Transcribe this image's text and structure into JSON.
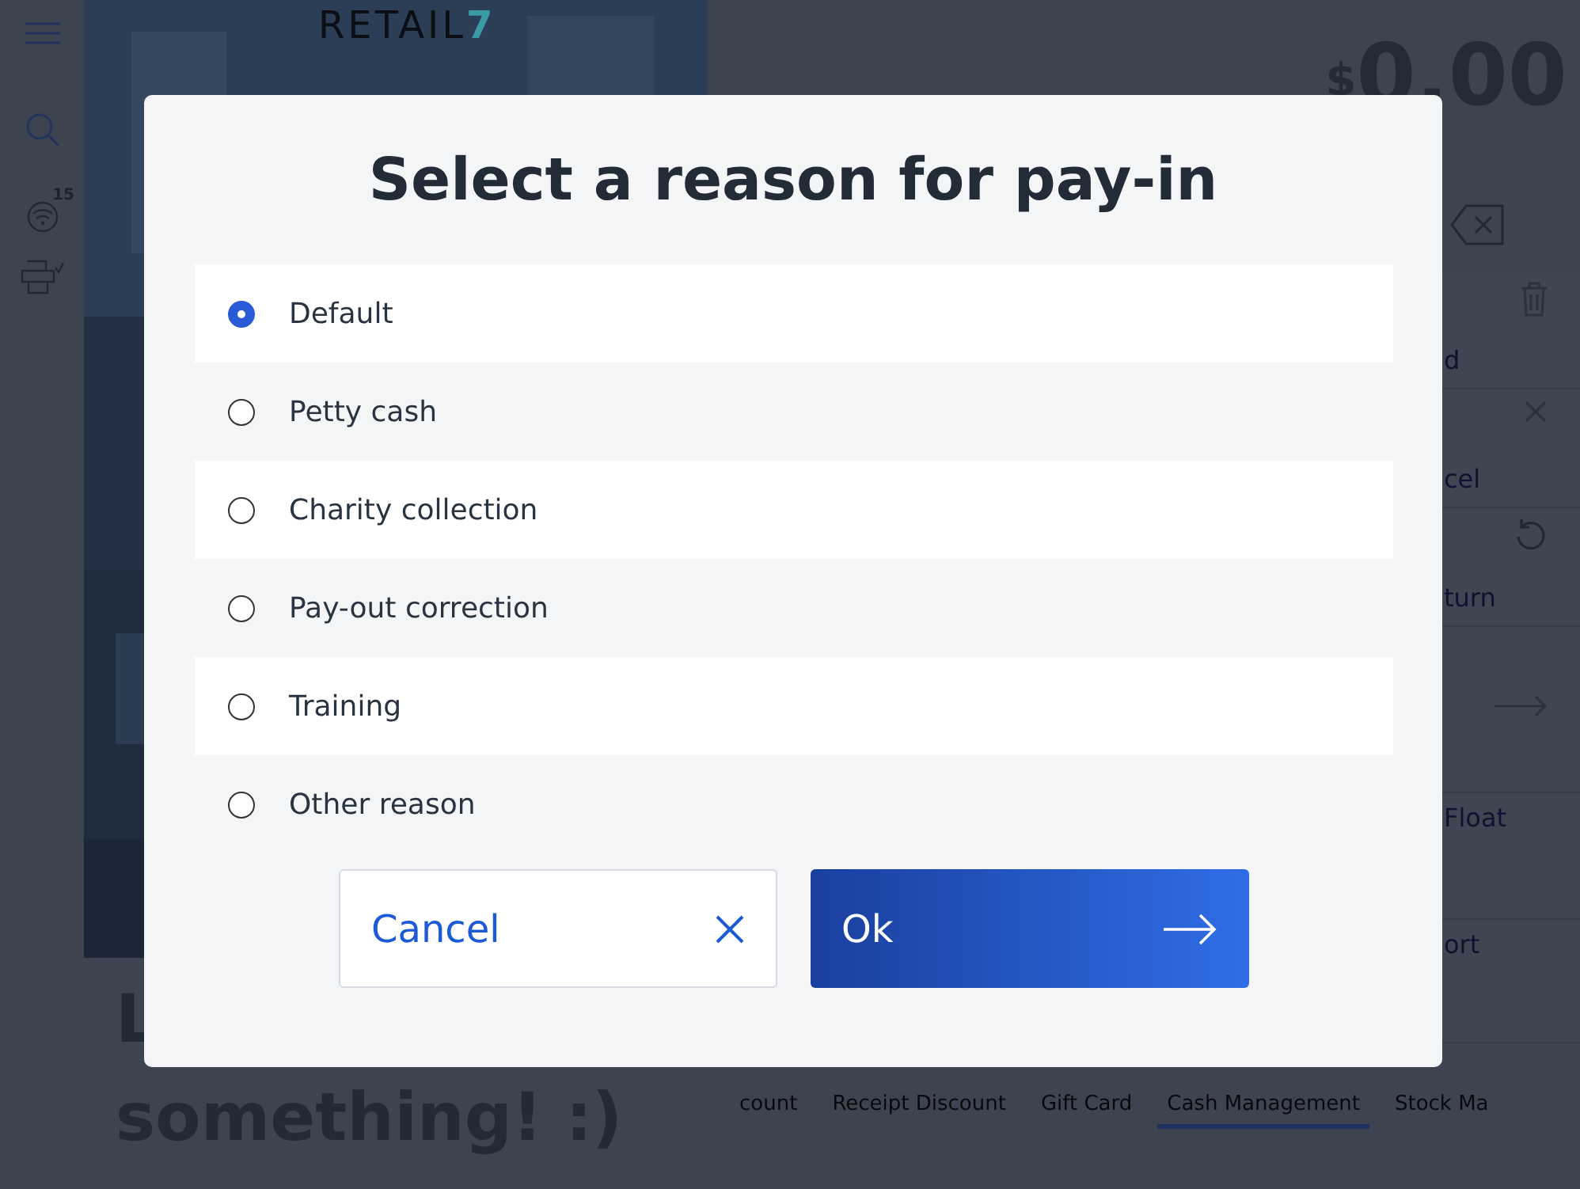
{
  "sidebar": {
    "badge": "15"
  },
  "logo": {
    "text": "RETAIL",
    "mark": "7"
  },
  "heading": {
    "first_line": "L",
    "second_line": "something! :)"
  },
  "amount": {
    "currency": "$",
    "value": "0.00"
  },
  "side_buttons": [
    {
      "label": "d",
      "kind": "trash"
    },
    {
      "label": "cel",
      "kind": "close"
    },
    {
      "label": "turn",
      "kind": "undo"
    },
    {
      "kind": "arrow"
    },
    {
      "label": "Float",
      "kind": "plain"
    },
    {
      "label": "ort",
      "kind": "plain"
    }
  ],
  "tabs": [
    {
      "label": "count",
      "selected": false
    },
    {
      "label": "Receipt Discount",
      "selected": false
    },
    {
      "label": "Gift Card",
      "selected": false
    },
    {
      "label": "Cash Management",
      "selected": true
    },
    {
      "label": "Stock Ma",
      "selected": false
    }
  ],
  "dialog": {
    "title": "Select a reason for pay-in",
    "options": [
      {
        "label": "Default",
        "selected": true
      },
      {
        "label": "Petty cash",
        "selected": false
      },
      {
        "label": "Charity collection",
        "selected": false
      },
      {
        "label": "Pay-out correction",
        "selected": false
      },
      {
        "label": "Training",
        "selected": false
      },
      {
        "label": "Other reason",
        "selected": false
      }
    ],
    "cancel": "Cancel",
    "ok": "Ok"
  }
}
